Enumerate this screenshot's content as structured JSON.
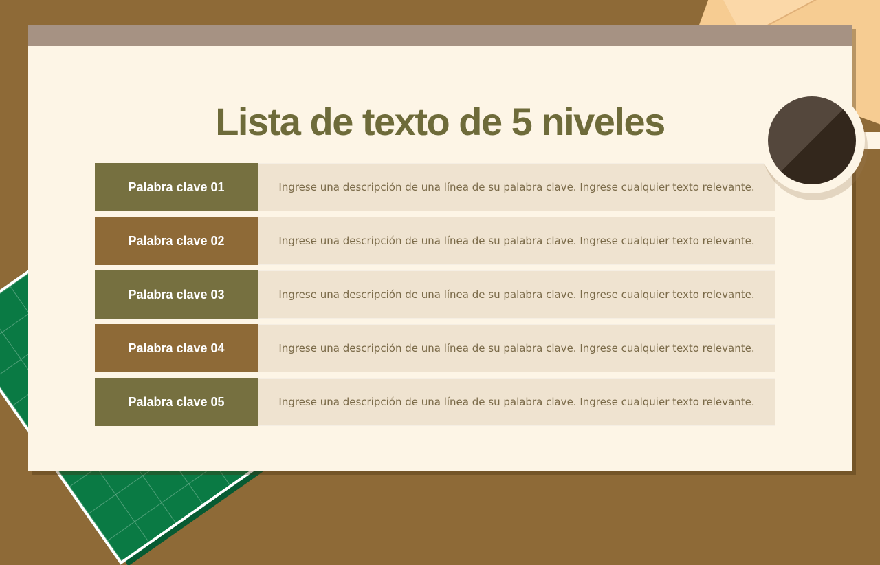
{
  "slide": {
    "title": "Lista de texto de 5 niveles",
    "items": [
      {
        "keyword": "Palabra clave 01",
        "description": "Ingrese una descripción de una línea de su palabra clave. Ingrese cualquier texto relevante.",
        "color": "#767040"
      },
      {
        "keyword": "Palabra clave 02",
        "description": "Ingrese una descripción de una línea de su palabra clave. Ingrese cualquier texto relevante.",
        "color": "#8e6a37"
      },
      {
        "keyword": "Palabra clave 03",
        "description": "Ingrese una descripción de una línea de su palabra clave. Ingrese cualquier texto relevante.",
        "color": "#767040"
      },
      {
        "keyword": "Palabra clave 04",
        "description": "Ingrese una descripción de una línea de su palabra clave. Ingrese cualquier texto relevante.",
        "color": "#8e6a37"
      },
      {
        "keyword": "Palabra clave 05",
        "description": "Ingrese una descripción de una línea de su palabra clave. Ingrese cualquier texto relevante.",
        "color": "#767040"
      }
    ]
  },
  "colors": {
    "background": "#8e6a37",
    "card": "#fdf5e6",
    "card_bar": "#a69283",
    "title": "#6e6b3a",
    "olive": "#767040",
    "brown": "#8e6a37",
    "desc_bg": "#efe3d0"
  },
  "decorations": {
    "cutting_mat": "green-grid-mat",
    "paper": "folded-paper-sheet",
    "cup": "coffee-cup-icon"
  }
}
